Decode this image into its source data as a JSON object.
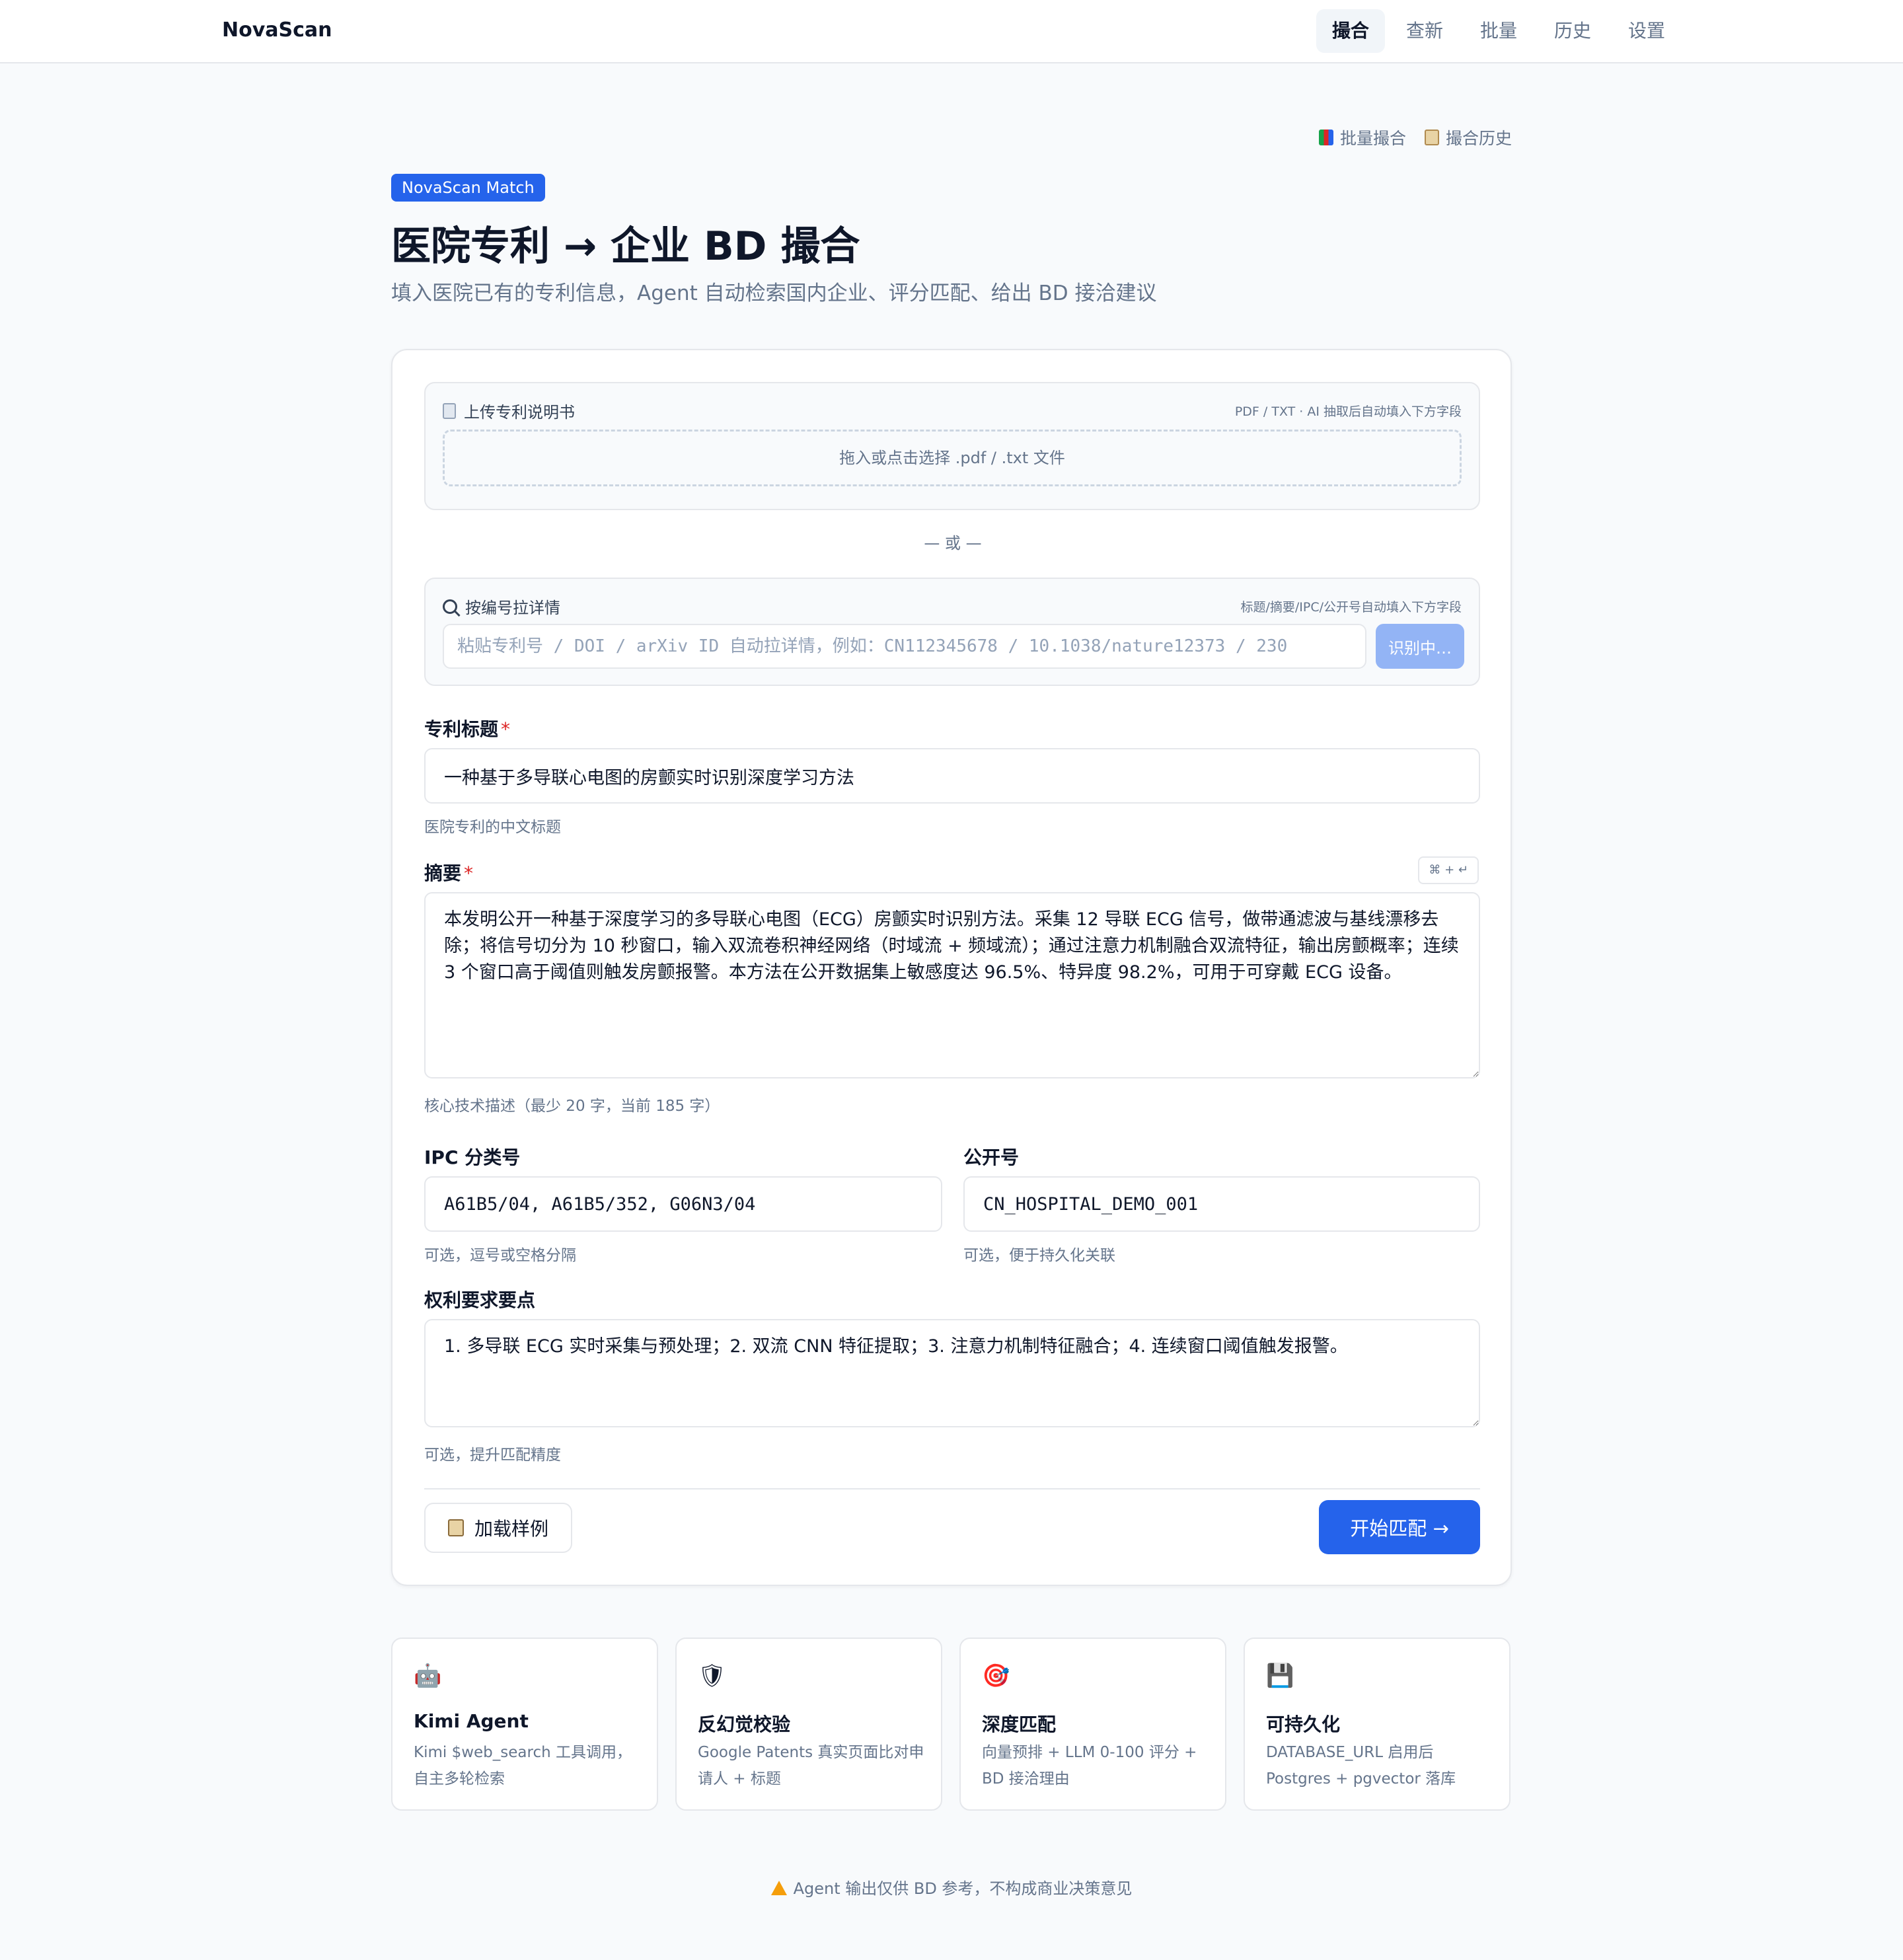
{
  "brand": "NovaScan",
  "nav": [
    {
      "label": "撮合",
      "active": true
    },
    {
      "label": "查新"
    },
    {
      "label": "批量"
    },
    {
      "label": "历史"
    },
    {
      "label": "设置"
    }
  ],
  "quick_links": {
    "batch": "批量撮合",
    "history": "撮合历史"
  },
  "badge": "NovaScan Match",
  "title": "医院专利 → 企业 BD 撮合",
  "subtitle": "填入医院已有的专利信息，Agent 自动检索国内企业、评分匹配、给出 BD 接洽建议",
  "upload": {
    "title": "上传专利说明书",
    "hint": "PDF / TXT · AI 抽取后自动填入下方字段",
    "dropzone": "拖入或点击选择 .pdf / .txt 文件"
  },
  "or_text": "— 或 —",
  "fetch": {
    "title": "按编号拉详情",
    "hint": "标题/摘要/IPC/公开号自动填入下方字段",
    "placeholder": "粘贴专利号 / DOI / arXiv ID 自动拉详情，例如：CN112345678 / 10.1038/nature12373 / 230",
    "button": "识别中…"
  },
  "form": {
    "title_label": "专利标题",
    "title_value": "一种基于多导联心电图的房颤实时识别深度学习方法",
    "title_help": "医院专利的中文标题",
    "abstract_label": "摘要",
    "abstract_shortcut": "⌘ + ↵",
    "abstract_value": "本发明公开一种基于深度学习的多导联心电图（ECG）房颤实时识别方法。采集 12 导联 ECG 信号，做带通滤波与基线漂移去除；将信号切分为 10 秒窗口，输入双流卷积神经网络（时域流 + 频域流）；通过注意力机制融合双流特征，输出房颤概率；连续 3 个窗口高于阈值则触发房颤报警。本方法在公开数据集上敏感度达 96.5%、特异度 98.2%，可用于可穿戴 ECG 设备。",
    "abstract_help": "核心技术描述（最少 20 字，当前 185 字）",
    "ipc_label": "IPC 分类号",
    "ipc_value": "A61B5/04, A61B5/352, G06N3/04",
    "ipc_help": "可选，逗号或空格分隔",
    "pub_label": "公开号",
    "pub_value": "CN_HOSPITAL_DEMO_001",
    "pub_help": "可选，便于持久化关联",
    "claims_label": "权利要求要点",
    "claims_value": "1. 多导联 ECG 实时采集与预处理；2. 双流 CNN 特征提取；3. 注意力机制特征融合；4. 连续窗口阈值触发报警。",
    "claims_help": "可选，提升匹配精度",
    "required_mark": "*"
  },
  "actions": {
    "load_sample": "加载样例",
    "start": "开始匹配 →"
  },
  "features": [
    {
      "icon": "robot-icon",
      "glyph": "🤖",
      "title": "Kimi Agent",
      "desc": "Kimi $web_search 工具调用，自主多轮检索"
    },
    {
      "icon": "shield-icon",
      "glyph": "🛡",
      "title": "反幻觉校验",
      "desc": "Google Patents 真实页面比对申请人 + 标题"
    },
    {
      "icon": "target-icon",
      "glyph": "🎯",
      "title": "深度匹配",
      "desc": "向量预排 + LLM 0-100 评分 + BD 接洽理由"
    },
    {
      "icon": "floppy-icon",
      "glyph": "💾",
      "title": "可持久化",
      "desc": "DATABASE_URL 启用后 Postgres + pgvector 落库"
    }
  ],
  "footer": "Agent 输出仅供 BD 参考，不构成商业决策意见"
}
